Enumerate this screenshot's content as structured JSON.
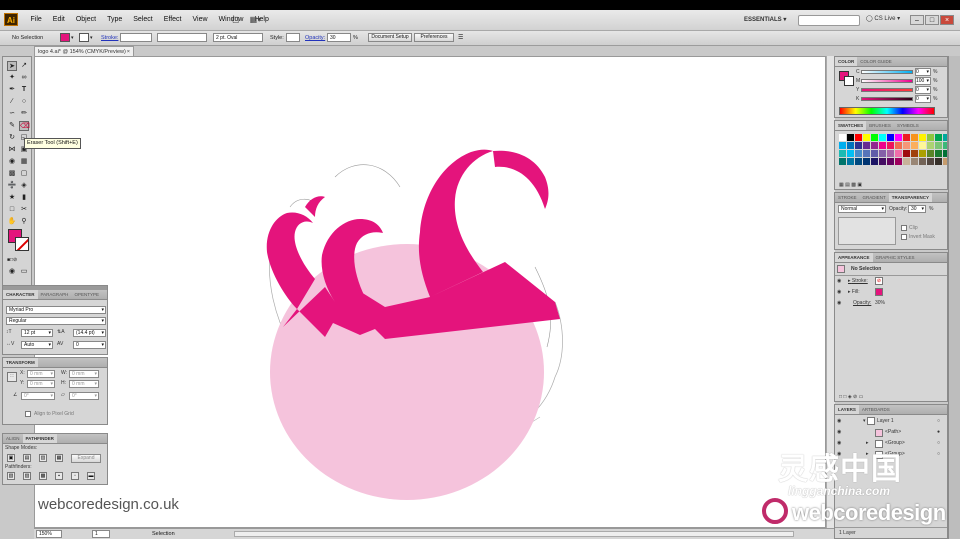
{
  "menubar": {
    "logo": "Ai",
    "items": [
      "File",
      "Edit",
      "Object",
      "Type",
      "Select",
      "Effect",
      "View",
      "Window",
      "Help"
    ],
    "workspace": "ESSENTIALS",
    "cs_live": "CS Live"
  },
  "control": {
    "selection": "No Selection",
    "stroke_label": "Stroke:",
    "brush": "2 pt. Oval",
    "style_label": "Style:",
    "opacity_label": "Opacity:",
    "opacity": "30",
    "opacity_unit": "%",
    "doc_setup": "Document Setup",
    "preferences": "Preferences",
    "fill_color": "#e4147c"
  },
  "document": {
    "tab": "logo 4.ai* @ 154% (CMYK/Preview)",
    "zoom": "150%",
    "page": "1",
    "status": "Selection"
  },
  "toolbox": {
    "tooltip": "Eraser Tool (Shift+E)"
  },
  "character": {
    "tab1": "CHARACTER",
    "tab2": "PARAGRAPH",
    "tab3": "OPENTYPE",
    "font": "Myriad Pro",
    "style": "Regular",
    "size": "12 pt",
    "leading": "(14.4 pt)",
    "kerning": "Auto",
    "tracking": "0"
  },
  "transform": {
    "title": "TRANSFORM",
    "x_label": "X:",
    "x": "0 mm",
    "y_label": "Y:",
    "y": "0 mm",
    "w_label": "W:",
    "w": "0 mm",
    "h_label": "H:",
    "h": "0 mm",
    "angle": "0°",
    "shear": "0°",
    "align": "Align to Pixel Grid"
  },
  "pathfinder": {
    "tab1": "ALIGN",
    "tab2": "PATHFINDER",
    "shape_modes": "Shape Modes:",
    "expand": "Expand",
    "pathfinders": "Pathfinders:"
  },
  "color": {
    "tab1": "COLOR",
    "tab2": "COLOR GUIDE",
    "c_label": "C",
    "c": "0",
    "m_label": "M",
    "m": "100",
    "y_label": "Y",
    "y": "0",
    "k_label": "K",
    "k": "0",
    "unit": "%"
  },
  "swatches": {
    "tab1": "SWATCHES",
    "tab2": "BRUSHES",
    "tab3": "SYMBOLS"
  },
  "transparency": {
    "tab1": "STROKE",
    "tab2": "GRADIENT",
    "tab3": "TRANSPARENCY",
    "mode": "Normal",
    "opacity_label": "Opacity:",
    "opacity": "30",
    "unit": "%",
    "clip": "Clip",
    "invert": "Invert Mask"
  },
  "appearance": {
    "tab1": "APPEARANCE",
    "tab2": "GRAPHIC STYLES",
    "title": "No Selection",
    "stroke": "Stroke:",
    "fill": "Fill:",
    "opacity_label": "Opacity:",
    "opacity": "30%"
  },
  "layers": {
    "tab1": "LAYERS",
    "tab2": "ARTBOARDS",
    "layer1": "Layer 1",
    "path": "<Path>",
    "group1": "<Group>",
    "group2": "<Group>",
    "count": "1 Layer"
  },
  "watermark": {
    "site": "webcoredesign.co.uk",
    "cn_title": "灵感中国",
    "cn_url": "lingganchina.com",
    "brand": "webcoredesign"
  },
  "colors": {
    "magenta": "#e4147c",
    "pink_light": "#f5c3dc"
  }
}
